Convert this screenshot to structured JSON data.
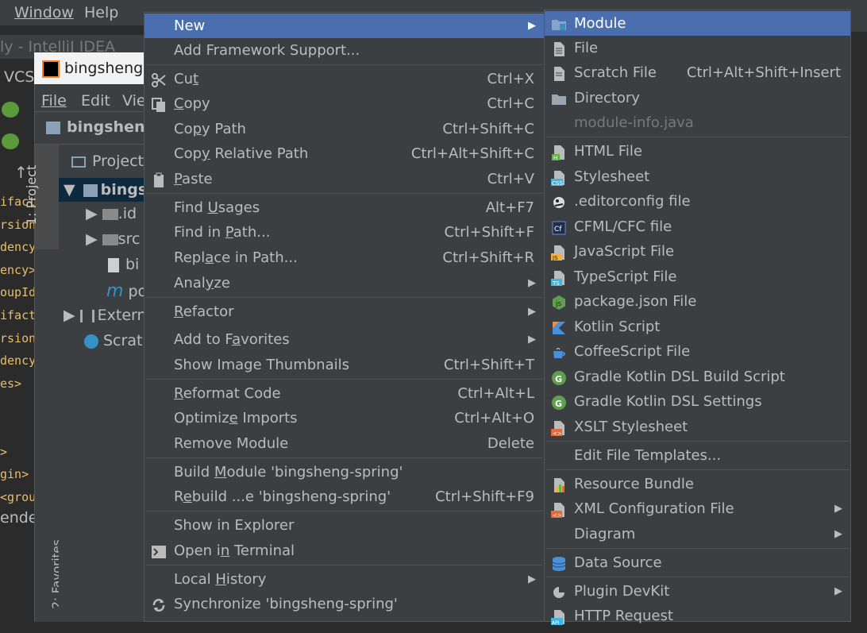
{
  "background": {
    "menubar": {
      "window": "Window",
      "help": "Help"
    },
    "outer_title": "ly - IntelliJ IDEA",
    "left_fragments": [
      "VCS"
    ],
    "window_title": "bingsheng-",
    "inner_menubar": {
      "file": "File",
      "edit": "Edit",
      "view": "Vie"
    },
    "nav_label": "bingsheng",
    "side_tab": "1: Project",
    "favorites_tab": "2: Favorites",
    "project_header": "Project",
    "tree": [
      "bings",
      ".id",
      "src",
      "bi",
      "po",
      "Extern",
      "Scrat"
    ],
    "code_lines": [
      "ifact",
      "rsion>",
      "dency>",
      "ency>",
      "oupId>",
      "ifact",
      "rsion>",
      "dency>",
      "es>",
      "",
      "",
      ">",
      "gin>",
      "<grou",
      "ender"
    ]
  },
  "main_menu": {
    "items": [
      {
        "label": "New",
        "shortcut": "",
        "submenu": true,
        "highlighted": true
      },
      {
        "label": "Add Framework Support...",
        "shortcut": ""
      },
      {
        "label": "Cut",
        "shortcut": "Ctrl+X",
        "icon": "scissors-icon"
      },
      {
        "label": "Copy",
        "shortcut": "Ctrl+C",
        "icon": "copy-icon"
      },
      {
        "label": "Copy Path",
        "shortcut": "Ctrl+Shift+C"
      },
      {
        "label": "Copy Relative Path",
        "shortcut": "Ctrl+Alt+Shift+C"
      },
      {
        "label": "Paste",
        "shortcut": "Ctrl+V",
        "icon": "clipboard-icon"
      },
      {
        "label": "Find Usages",
        "shortcut": "Alt+F7"
      },
      {
        "label": "Find in Path...",
        "shortcut": "Ctrl+Shift+F"
      },
      {
        "label": "Replace in Path...",
        "shortcut": "Ctrl+Shift+R"
      },
      {
        "label": "Analyze",
        "shortcut": "",
        "submenu": true
      },
      {
        "label": "Refactor",
        "shortcut": "",
        "submenu": true
      },
      {
        "label": "Add to Favorites",
        "shortcut": "",
        "submenu": true
      },
      {
        "label": "Show Image Thumbnails",
        "shortcut": "Ctrl+Shift+T"
      },
      {
        "label": "Reformat Code",
        "shortcut": "Ctrl+Alt+L"
      },
      {
        "label": "Optimize Imports",
        "shortcut": "Ctrl+Alt+O"
      },
      {
        "label": "Remove Module",
        "shortcut": "Delete"
      },
      {
        "label": "Build Module 'bingsheng-spring'",
        "shortcut": ""
      },
      {
        "label": "Rebuild ...e 'bingsheng-spring'",
        "shortcut": "Ctrl+Shift+F9"
      },
      {
        "label": "Show in Explorer",
        "shortcut": ""
      },
      {
        "label": "Open in Terminal",
        "shortcut": "",
        "icon": "terminal-icon"
      },
      {
        "label": "Local History",
        "shortcut": "",
        "submenu": true
      },
      {
        "label": "Synchronize 'bingsheng-spring'",
        "shortcut": "",
        "icon": "sync-icon"
      }
    ]
  },
  "new_submenu": {
    "items": [
      {
        "label": "Module",
        "highlighted": true,
        "icon": "module-folder-icon"
      },
      {
        "label": "File",
        "icon": "file-icon"
      },
      {
        "label": "Scratch File",
        "shortcut": "Ctrl+Alt+Shift+Insert",
        "icon": "scratch-file-icon"
      },
      {
        "label": "Directory",
        "icon": "folder-icon"
      },
      {
        "label": "module-info.java",
        "disabled": true
      },
      {
        "label": "HTML File",
        "icon": "html-file-icon"
      },
      {
        "label": "Stylesheet",
        "icon": "css-file-icon"
      },
      {
        "label": ".editorconfig file",
        "icon": "editorconfig-icon"
      },
      {
        "label": "CFML/CFC file",
        "icon": "cfml-icon"
      },
      {
        "label": "JavaScript File",
        "icon": "javascript-file-icon"
      },
      {
        "label": "TypeScript File",
        "icon": "typescript-file-icon"
      },
      {
        "label": "package.json File",
        "icon": "nodejs-icon"
      },
      {
        "label": "Kotlin Script",
        "icon": "kotlin-icon"
      },
      {
        "label": "CoffeeScript File",
        "icon": "coffeescript-icon"
      },
      {
        "label": "Gradle Kotlin DSL Build Script",
        "icon": "gradle-icon"
      },
      {
        "label": "Gradle Kotlin DSL Settings",
        "icon": "gradle-icon"
      },
      {
        "label": "XSLT Stylesheet",
        "icon": "xslt-icon"
      },
      {
        "label": "Edit File Templates..."
      },
      {
        "label": "Resource Bundle",
        "icon": "resource-bundle-icon"
      },
      {
        "label": "XML Configuration File",
        "submenu": true,
        "icon": "xml-config-icon"
      },
      {
        "label": "Diagram",
        "submenu": true
      },
      {
        "label": "Data Source",
        "icon": "database-icon"
      },
      {
        "label": "Plugin DevKit",
        "submenu": true,
        "icon": "plugin-icon"
      },
      {
        "label": "HTTP Request",
        "icon": "api-icon"
      }
    ]
  },
  "colors": {
    "menu_bg": "#3c3f41",
    "highlight": "#4b6eaf",
    "text": "#bbbbbb",
    "disabled": "#787878",
    "editor_bg": "#2b2b2b"
  }
}
